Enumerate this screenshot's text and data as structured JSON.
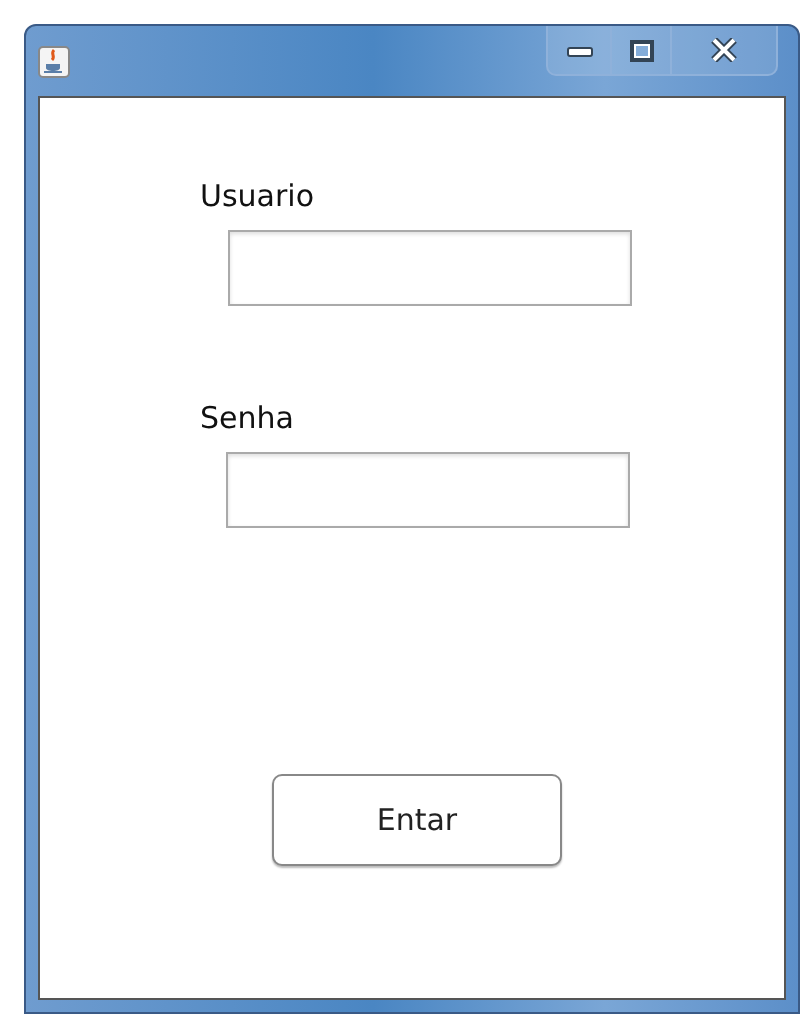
{
  "fields": [
    {
      "label": "Usuario"
    },
    {
      "label": "Senha"
    }
  ],
  "button": "Entar"
}
